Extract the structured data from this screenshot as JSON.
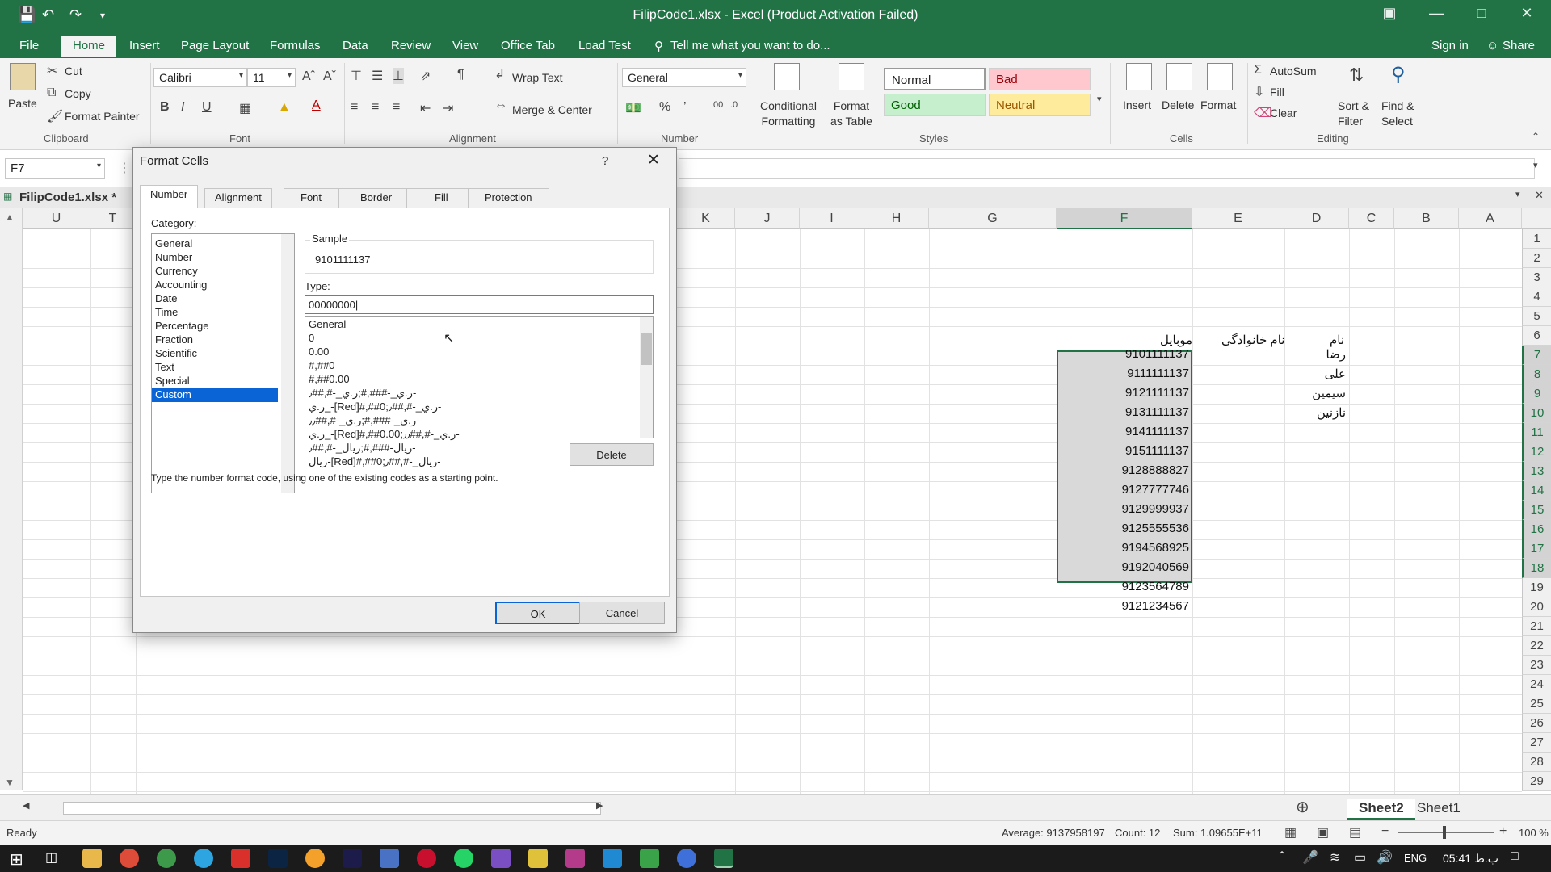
{
  "window": {
    "title": "FilipCode1.xlsx - Excel (Product Activation Failed)"
  },
  "ribbon_tabs": [
    "File",
    "Home",
    "Insert",
    "Page Layout",
    "Formulas",
    "Data",
    "Review",
    "View",
    "Office Tab",
    "Load Test"
  ],
  "tell_me": "Tell me what you want to do...",
  "account": {
    "sign_in": "Sign in",
    "share": "Share"
  },
  "clipboard": {
    "paste": "Paste",
    "cut": "Cut",
    "copy": "Copy",
    "format_painter": "Format Painter",
    "group": "Clipboard"
  },
  "font": {
    "name": "Calibri",
    "size": "11",
    "group": "Font"
  },
  "alignment": {
    "wrap": "Wrap Text",
    "merge": "Merge & Center",
    "group": "Alignment"
  },
  "number": {
    "format": "General",
    "group": "Number"
  },
  "styles": {
    "conditional": "Conditional Formatting",
    "format_as": "Format as Table",
    "normal": "Normal",
    "bad": "Bad",
    "good": "Good",
    "neutral": "Neutral",
    "group": "Styles"
  },
  "cells": {
    "insert": "Insert",
    "delete": "Delete",
    "format": "Format",
    "group": "Cells"
  },
  "editing": {
    "autosum": "AutoSum",
    "fill": "Fill",
    "clear": "Clear",
    "sort": "Sort & Filter",
    "find": "Find & Select",
    "group": "Editing"
  },
  "name_box": "F7",
  "workbook_tab": "FilipCode1.xlsx *",
  "columns_right": [
    "K",
    "J",
    "I",
    "H",
    "G",
    "F",
    "E",
    "D",
    "C",
    "B",
    "A"
  ],
  "columns_left": [
    "U",
    "T"
  ],
  "rows": [
    "1",
    "2",
    "3",
    "4",
    "5",
    "6",
    "7",
    "8",
    "9",
    "10",
    "11",
    "12",
    "13",
    "14",
    "15",
    "16",
    "17",
    "18",
    "19",
    "20",
    "21",
    "22",
    "23",
    "24",
    "25",
    "26",
    "27",
    "28",
    "29"
  ],
  "headers": {
    "mobile": "موبایل",
    "family": "نام خانوادگی",
    "name": "نام"
  },
  "names": [
    "رضا",
    "علی",
    "سیمین",
    "نازنین"
  ],
  "mobiles": [
    "9101111137",
    "9111111137",
    "9121111137",
    "9131111137",
    "9141111137",
    "9151111137",
    "9128888827",
    "9127777746",
    "9129999937",
    "9125555536",
    "9194568925",
    "9192040569",
    "9123564789",
    "9121234567"
  ],
  "sheets": [
    "Sheet2",
    "Sheet1"
  ],
  "status": {
    "ready": "Ready",
    "average": "Average: 9137958197",
    "count": "Count: 12",
    "sum": "Sum: 1.09655E+11",
    "zoom": "100 %"
  },
  "taskbar": {
    "lang": "ENG",
    "time": "05:41 ب.ظ"
  },
  "dialog": {
    "title": "Format Cells",
    "help": "?",
    "tabs": [
      "Number",
      "Alignment",
      "Font",
      "Border",
      "Fill",
      "Protection"
    ],
    "category_label": "Category:",
    "categories": [
      "General",
      "Number",
      "Currency",
      "Accounting",
      "Date",
      "Time",
      "Percentage",
      "Fraction",
      "Scientific",
      "Text",
      "Special",
      "Custom"
    ],
    "sample_label": "Sample",
    "sample_value": "9101111137",
    "type_label": "Type:",
    "type_value": "00000000",
    "type_list": [
      "General",
      "0",
      "0.00",
      "#,##0",
      "#,##0.00",
      "ر.ي_-###,#;ر.ي_-#,##٫-",
      "ر.ي_-[Red]#,##0;ر.ي_-#,##٫-",
      "ر.ي_-###,#;ر.ي_-#,##٫٫-",
      "ر.ي_-[Red]#,##0.00;ر.ي_-#,##٫٫-",
      "ریال-###,#;ریال_-#,##٫-",
      "ریال-[Red]#,##0;ریال_-#,##٫-"
    ],
    "delete": "Delete",
    "hint": "Type the number format code, using one of the existing codes as a starting point.",
    "ok": "OK",
    "cancel": "Cancel"
  }
}
